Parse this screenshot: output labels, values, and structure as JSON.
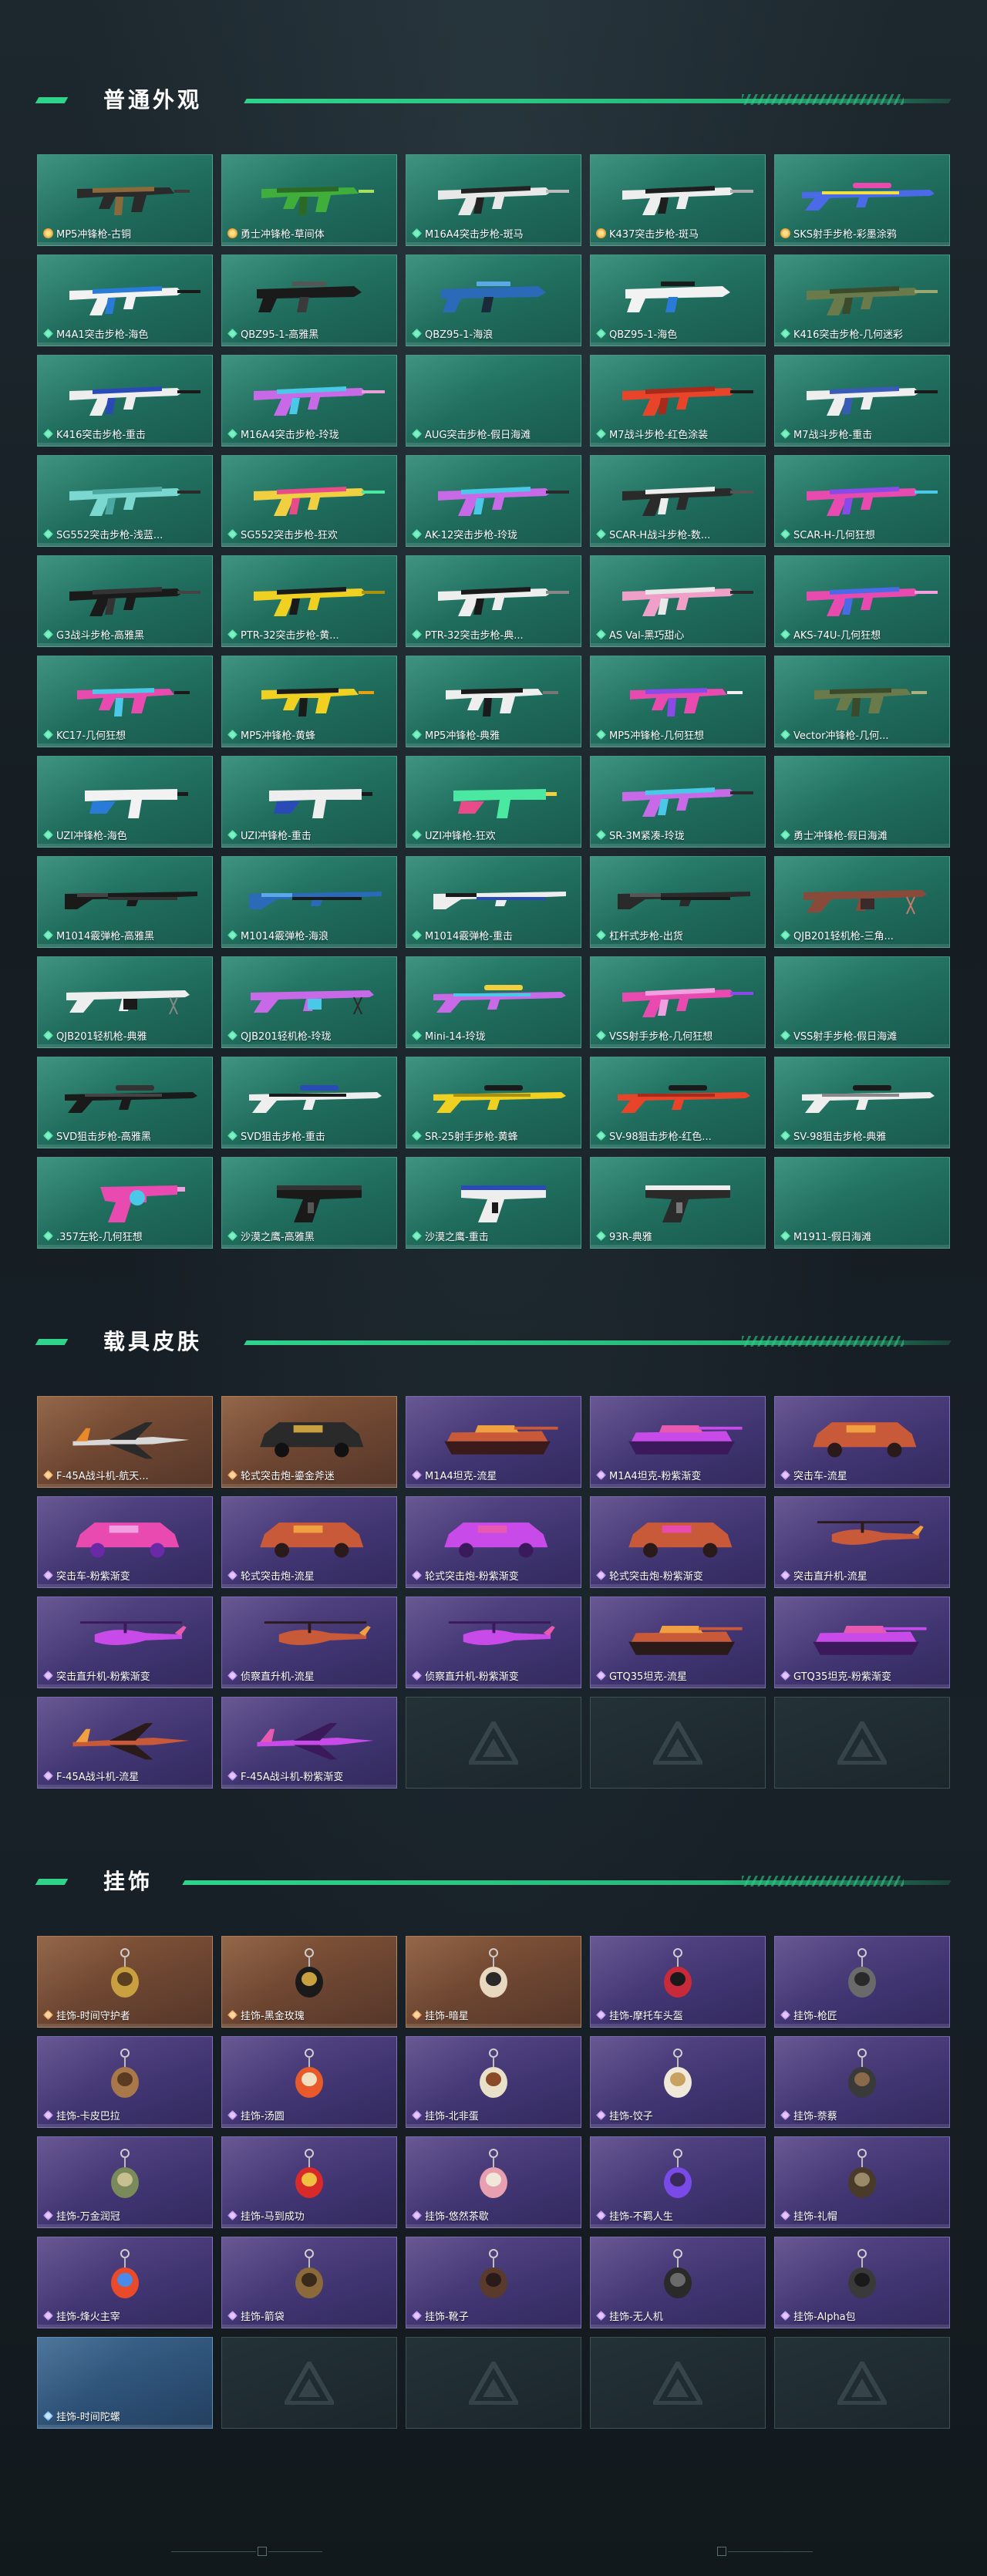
{
  "sections": [
    {
      "title": "普通外观"
    },
    {
      "title": "载具皮肤"
    },
    {
      "title": "挂饰"
    }
  ],
  "weapons": [
    {
      "name": "MP5冲锋枪-古铜",
      "rarity": "gold",
      "gun": "smg",
      "colors": [
        "#2a2a2a",
        "#8a6a3a",
        "#3a3a3a"
      ]
    },
    {
      "name": "勇士冲锋枪-草间体",
      "rarity": "gold",
      "gun": "smg",
      "colors": [
        "#3fae3a",
        "#2a6a25",
        "#a8e060"
      ]
    },
    {
      "name": "M16A4突击步枪-斑马",
      "rarity": "green",
      "gun": "rifle",
      "colors": [
        "#e8e8e8",
        "#222222",
        "#bbbbbb"
      ]
    },
    {
      "name": "K437突击步枪-斑马",
      "rarity": "gold",
      "gun": "rifle",
      "colors": [
        "#eeeeee",
        "#1e1e1e",
        "#aaaaaa"
      ]
    },
    {
      "name": "SKS射手步枪-彩墨涂鸦",
      "rarity": "gold",
      "gun": "sniper",
      "colors": [
        "#4a6ae8",
        "#e84ab0",
        "#f0e040"
      ]
    },
    {
      "name": "M4A1突击步枪-海色",
      "rarity": "green",
      "gun": "rifle",
      "colors": [
        "#f2f2f2",
        "#2a7ad8",
        "#1a1a1a"
      ]
    },
    {
      "name": "QBZ95-1-高雅黑",
      "rarity": "green",
      "gun": "bullpup",
      "colors": [
        "#1a1a1a",
        "#3a3a3a",
        "#555555"
      ]
    },
    {
      "name": "QBZ95-1-海浪",
      "rarity": "green",
      "gun": "bullpup",
      "colors": [
        "#2a6ab8",
        "#1a2a3a",
        "#5aa8e8"
      ]
    },
    {
      "name": "QBZ95-1-海色",
      "rarity": "green",
      "gun": "bullpup",
      "colors": [
        "#f2f2f2",
        "#2a7ad8",
        "#1a1a1a"
      ]
    },
    {
      "name": "K416突击步枪-几何迷彩",
      "rarity": "green",
      "gun": "rifle",
      "colors": [
        "#6a7a4a",
        "#3a4a2a",
        "#9aa870"
      ]
    },
    {
      "name": "K416突击步枪-重击",
      "rarity": "green",
      "gun": "rifle",
      "colors": [
        "#eeeeee",
        "#2a4ab8",
        "#1a1a1a"
      ]
    },
    {
      "name": "M16A4突击步枪-玲珑",
      "rarity": "green",
      "gun": "rifle",
      "colors": [
        "#c86ae8",
        "#4ac8e8",
        "#e8a0d8"
      ]
    },
    {
      "name": "AUG突击步枪-假日海滩",
      "rarity": "green",
      "gun": "none",
      "colors": [
        "#1f6b5c",
        "#1f6b5c",
        "#1f6b5c"
      ]
    },
    {
      "name": "M7战斗步枪-红色涂装",
      "rarity": "green",
      "gun": "rifle",
      "colors": [
        "#e8442a",
        "#a82a1a",
        "#1a1a1a"
      ]
    },
    {
      "name": "M7战斗步枪-重击",
      "rarity": "green",
      "gun": "rifle",
      "colors": [
        "#eeeeee",
        "#3a5ab8",
        "#1a1a1a"
      ]
    },
    {
      "name": "SG552突击步枪-浅蓝...",
      "rarity": "green",
      "gun": "rifle",
      "colors": [
        "#7ad8d0",
        "#4aa8a0",
        "#2a2a2a"
      ]
    },
    {
      "name": "SG552突击步枪-狂欢",
      "rarity": "green",
      "gun": "rifle",
      "colors": [
        "#f0d040",
        "#e84a8a",
        "#4ae8a0"
      ]
    },
    {
      "name": "AK-12突击步枪-玲珑",
      "rarity": "green",
      "gun": "rifle",
      "colors": [
        "#c86ae8",
        "#4ac8e8",
        "#2a2a2a"
      ]
    },
    {
      "name": "SCAR-H战斗步枪-数...",
      "rarity": "green",
      "gun": "rifle",
      "colors": [
        "#2a2a2a",
        "#eeeeee",
        "#555555"
      ]
    },
    {
      "name": "SCAR-H-几何狂想",
      "rarity": "green",
      "gun": "rifle",
      "colors": [
        "#e84ab0",
        "#8a4ae8",
        "#4ac8e8"
      ]
    },
    {
      "name": "G3战斗步枪-高雅黑",
      "rarity": "green",
      "gun": "rifle",
      "colors": [
        "#1a1a1a",
        "#333333",
        "#444444"
      ]
    },
    {
      "name": "PTR-32突击步枪-黄...",
      "rarity": "green",
      "gun": "rifle",
      "colors": [
        "#f0d020",
        "#1a1a1a",
        "#a89010"
      ]
    },
    {
      "name": "PTR-32突击步枪-典...",
      "rarity": "green",
      "gun": "rifle",
      "colors": [
        "#eeeeee",
        "#1a1a1a",
        "#888888"
      ]
    },
    {
      "name": "AS Val-黑巧甜心",
      "rarity": "green",
      "gun": "rifle",
      "colors": [
        "#f0a0c8",
        "#e8e8e8",
        "#2a2a2a"
      ]
    },
    {
      "name": "AKS-74U-几何狂想",
      "rarity": "green",
      "gun": "rifle",
      "colors": [
        "#e84ab0",
        "#4a6ae8",
        "#f0a0e0"
      ]
    },
    {
      "name": "KC17-几何狂想",
      "rarity": "green",
      "gun": "smg",
      "colors": [
        "#e84ab0",
        "#4ac8e8",
        "#1a1a1a"
      ]
    },
    {
      "name": "MP5冲锋枪-黄蜂",
      "rarity": "green",
      "gun": "smg",
      "colors": [
        "#f0d020",
        "#1a1a1a",
        "#e8a010"
      ]
    },
    {
      "name": "MP5冲锋枪-典雅",
      "rarity": "green",
      "gun": "smg",
      "colors": [
        "#eeeeee",
        "#1a1a1a",
        "#777777"
      ]
    },
    {
      "name": "MP5冲锋枪-几何狂想",
      "rarity": "green",
      "gun": "smg",
      "colors": [
        "#e84ab0",
        "#8a4ae8",
        "#f0f0f0"
      ]
    },
    {
      "name": "Vector冲锋枪-几何...",
      "rarity": "green",
      "gun": "smg",
      "colors": [
        "#6a7a4a",
        "#3a4a2a",
        "#aab080"
      ]
    },
    {
      "name": "UZI冲锋枪-海色",
      "rarity": "green",
      "gun": "uzi",
      "colors": [
        "#f2f2f2",
        "#2a7ad8",
        "#1a1a1a"
      ]
    },
    {
      "name": "UZI冲锋枪-重击",
      "rarity": "green",
      "gun": "uzi",
      "colors": [
        "#eeeeee",
        "#2a4ab8",
        "#1a1a1a"
      ]
    },
    {
      "name": "UZI冲锋枪-狂欢",
      "rarity": "green",
      "gun": "uzi",
      "colors": [
        "#4ae8a0",
        "#e84a8a",
        "#f0d040"
      ]
    },
    {
      "name": "SR-3M紧凑-玲珑",
      "rarity": "green",
      "gun": "rifle",
      "colors": [
        "#c86ae8",
        "#4ac8e8",
        "#2a2a2a"
      ]
    },
    {
      "name": "勇士冲锋枪-假日海滩",
      "rarity": "green",
      "gun": "none",
      "colors": [
        "#1f6b5c",
        "#1f6b5c",
        "#1f6b5c"
      ]
    },
    {
      "name": "M1014霰弹枪-高雅黑",
      "rarity": "green",
      "gun": "shotgun",
      "colors": [
        "#1a1a1a",
        "#333333",
        "#444444"
      ]
    },
    {
      "name": "M1014霰弹枪-海浪",
      "rarity": "green",
      "gun": "shotgun",
      "colors": [
        "#2a6ab8",
        "#1a1a1a",
        "#5aa8e8"
      ]
    },
    {
      "name": "M1014霰弹枪-重击",
      "rarity": "green",
      "gun": "shotgun",
      "colors": [
        "#eeeeee",
        "#2a4ab8",
        "#1a1a1a"
      ]
    },
    {
      "name": "杠杆式步枪-出货",
      "rarity": "green",
      "gun": "shotgun",
      "colors": [
        "#2a2a2a",
        "#1a1a1a",
        "#555555"
      ]
    },
    {
      "name": "QJB201轻机枪-三角...",
      "rarity": "green",
      "gun": "lmg",
      "colors": [
        "#8a4a3a",
        "#3a2a2a",
        "#c87a6a"
      ]
    },
    {
      "name": "QJB201轻机枪-典雅",
      "rarity": "green",
      "gun": "lmg",
      "colors": [
        "#eeeeee",
        "#1a1a1a",
        "#888888"
      ]
    },
    {
      "name": "QJB201轻机枪-玲珑",
      "rarity": "green",
      "gun": "lmg",
      "colors": [
        "#c86ae8",
        "#4ac8e8",
        "#2a2a2a"
      ]
    },
    {
      "name": "Mini-14-玲珑",
      "rarity": "green",
      "gun": "sniper",
      "colors": [
        "#c86ae8",
        "#f0d040",
        "#4ac8e8"
      ]
    },
    {
      "name": "VSS射手步枪-几何狂想",
      "rarity": "green",
      "gun": "rifle",
      "colors": [
        "#e84ab0",
        "#f0a0e0",
        "#8a4ae8"
      ]
    },
    {
      "name": "VSS射手步枪-假日海滩",
      "rarity": "green",
      "gun": "none",
      "colors": [
        "#1f6b5c",
        "#1f6b5c",
        "#1f6b5c"
      ]
    },
    {
      "name": "SVD狙击步枪-高雅黑",
      "rarity": "green",
      "gun": "sniper",
      "colors": [
        "#1a1a1a",
        "#333333",
        "#444444"
      ]
    },
    {
      "name": "SVD狙击步枪-重击",
      "rarity": "green",
      "gun": "sniper",
      "colors": [
        "#eeeeee",
        "#2a4ab8",
        "#1a1a1a"
      ]
    },
    {
      "name": "SR-25射手步枪-黄蜂",
      "rarity": "green",
      "gun": "sniper",
      "colors": [
        "#f0d020",
        "#1a1a1a",
        "#a89010"
      ]
    },
    {
      "name": "SV-98狙击步枪-红色...",
      "rarity": "green",
      "gun": "sniper",
      "colors": [
        "#e8442a",
        "#1a1a1a",
        "#a82a1a"
      ]
    },
    {
      "name": "SV-98狙击步枪-典雅",
      "rarity": "green",
      "gun": "sniper",
      "colors": [
        "#eeeeee",
        "#1a1a1a",
        "#888888"
      ]
    },
    {
      "name": ".357左轮-几何狂想",
      "rarity": "green",
      "gun": "revolver",
      "colors": [
        "#e84ab0",
        "#4ac8e8",
        "#f0a0e0"
      ]
    },
    {
      "name": "沙漠之鹰-高雅黑",
      "rarity": "green",
      "gun": "pistol",
      "colors": [
        "#1a1a1a",
        "#333333",
        "#555555"
      ]
    },
    {
      "name": "沙漠之鹰-重击",
      "rarity": "green",
      "gun": "pistol",
      "colors": [
        "#eeeeee",
        "#2a4ab8",
        "#1a1a1a"
      ]
    },
    {
      "name": "93R-典雅",
      "rarity": "green",
      "gun": "pistol",
      "colors": [
        "#2a2a2a",
        "#eeeeee",
        "#777777"
      ]
    },
    {
      "name": "M1911-假日海滩",
      "rarity": "green",
      "gun": "none",
      "colors": [
        "#1f6b5c",
        "#1f6b5c",
        "#1f6b5c"
      ]
    }
  ],
  "vehicles": [
    {
      "name": "F-45A战斗机-航天...",
      "rarity": "orange",
      "style": "orange",
      "kind": "jet",
      "colors": [
        "#d8d8d8",
        "#2a2a2a",
        "#e88a2a"
      ]
    },
    {
      "name": "轮式突击炮-鎏金斧迷",
      "rarity": "orange",
      "style": "orange",
      "kind": "truck",
      "colors": [
        "#2a2a2a",
        "#111111",
        "#c8a040"
      ]
    },
    {
      "name": "M1A4坦克-流星",
      "rarity": "purple",
      "style": "purple",
      "kind": "tank",
      "colors": [
        "#c85a3a",
        "#3a1a1a",
        "#f0a040"
      ]
    },
    {
      "name": "M1A4坦克-粉紫渐变",
      "rarity": "purple",
      "style": "purple",
      "kind": "tank",
      "colors": [
        "#c84ae8",
        "#3a1a5a",
        "#e85ab0"
      ]
    },
    {
      "name": "突击车-流星",
      "rarity": "purple",
      "style": "purple",
      "kind": "truck",
      "colors": [
        "#c85a3a",
        "#2a1a1a",
        "#f0a040"
      ]
    },
    {
      "name": "突击车-粉紫渐变",
      "rarity": "purple",
      "style": "purple",
      "kind": "truck",
      "colors": [
        "#e84ab0",
        "#6a2aa8",
        "#f0a0e0"
      ]
    },
    {
      "name": "轮式突击炮-流星",
      "rarity": "purple",
      "style": "purple",
      "kind": "truck",
      "colors": [
        "#c85a3a",
        "#2a1a1a",
        "#f0a040"
      ]
    },
    {
      "name": "轮式突击炮-粉紫渐变",
      "rarity": "purple",
      "style": "purple",
      "kind": "truck",
      "colors": [
        "#c84ae8",
        "#3a1a5a",
        "#e85ab0"
      ]
    },
    {
      "name": "轮式突击炮-粉紫渐变",
      "rarity": "purple",
      "style": "purple",
      "kind": "truck",
      "colors": [
        "#c85a3a",
        "#2a1a1a",
        "#e84ab0"
      ]
    },
    {
      "name": "突击直升机-流星",
      "rarity": "purple",
      "style": "purple",
      "kind": "heli",
      "colors": [
        "#c85a3a",
        "#2a1a1a",
        "#f0a040"
      ]
    },
    {
      "name": "突击直升机-粉紫渐变",
      "rarity": "purple",
      "style": "purple",
      "kind": "heli",
      "colors": [
        "#c84ae8",
        "#3a1a5a",
        "#e85ab0"
      ]
    },
    {
      "name": "侦察直升机-流星",
      "rarity": "purple",
      "style": "purple",
      "kind": "heli",
      "colors": [
        "#c85a3a",
        "#2a1a1a",
        "#f0a040"
      ]
    },
    {
      "name": "侦察直升机-粉紫渐变",
      "rarity": "purple",
      "style": "purple",
      "kind": "heli",
      "colors": [
        "#c84ae8",
        "#3a1a5a",
        "#e85ab0"
      ]
    },
    {
      "name": "GTQ35坦克-流星",
      "rarity": "purple",
      "style": "purple",
      "kind": "tank",
      "colors": [
        "#c85a3a",
        "#2a1a1a",
        "#f0a040"
      ]
    },
    {
      "name": "GTQ35坦克-粉紫渐变",
      "rarity": "purple",
      "style": "purple",
      "kind": "tank",
      "colors": [
        "#c84ae8",
        "#3a1a5a",
        "#e85ab0"
      ]
    },
    {
      "name": "F-45A战斗机-流星",
      "rarity": "purple",
      "style": "purple",
      "kind": "jet",
      "colors": [
        "#c85a3a",
        "#2a1a1a",
        "#f0a040"
      ]
    },
    {
      "name": "F-45A战斗机-粉紫渐变",
      "rarity": "purple",
      "style": "purple",
      "kind": "jet",
      "colors": [
        "#c84ae8",
        "#3a1a5a",
        "#e85ab0"
      ]
    },
    {
      "name": "",
      "rarity": "",
      "style": "empty",
      "kind": "none",
      "colors": []
    },
    {
      "name": "",
      "rarity": "",
      "style": "empty",
      "kind": "none",
      "colors": []
    },
    {
      "name": "",
      "rarity": "",
      "style": "empty",
      "kind": "none",
      "colors": []
    }
  ],
  "charms": [
    {
      "name": "挂饰-时间守护者",
      "rarity": "orange",
      "style": "orange",
      "colors": [
        "#c8a040",
        "#5a4020"
      ]
    },
    {
      "name": "挂饰-黑金玫瑰",
      "rarity": "orange",
      "style": "orange",
      "colors": [
        "#1a1a1a",
        "#c8a040"
      ]
    },
    {
      "name": "挂饰-暗星",
      "rarity": "orange",
      "style": "orange",
      "colors": [
        "#e8d8c0",
        "#2a2a2a"
      ]
    },
    {
      "name": "挂饰-摩托车头盔",
      "rarity": "purple",
      "style": "purple",
      "colors": [
        "#c82a3a",
        "#1a1a1a"
      ]
    },
    {
      "name": "挂饰-枪匠",
      "rarity": "purple",
      "style": "purple",
      "colors": [
        "#6a6a6a",
        "#2a2a2a"
      ]
    },
    {
      "name": "挂饰-卡皮巴拉",
      "rarity": "purple",
      "style": "purple",
      "colors": [
        "#a8784a",
        "#5a3a20"
      ]
    },
    {
      "name": "挂饰-汤圆",
      "rarity": "purple",
      "style": "purple",
      "colors": [
        "#e85a2a",
        "#f0e0c0"
      ]
    },
    {
      "name": "挂饰-北非蛋",
      "rarity": "purple",
      "style": "purple",
      "colors": [
        "#e8e0c8",
        "#8a4a2a"
      ]
    },
    {
      "name": "挂饰-饺子",
      "rarity": "purple",
      "style": "purple",
      "colors": [
        "#f0e8d8",
        "#c8a060"
      ]
    },
    {
      "name": "挂饰-萘蔡",
      "rarity": "purple",
      "style": "purple",
      "colors": [
        "#3a3a3a",
        "#8a6a4a"
      ]
    },
    {
      "name": "挂饰-万金润冠",
      "rarity": "purple",
      "style": "purple",
      "colors": [
        "#7a8a5a",
        "#c8c090"
      ]
    },
    {
      "name": "挂饰-马到成功",
      "rarity": "purple",
      "style": "purple",
      "colors": [
        "#d82a2a",
        "#f0c040"
      ]
    },
    {
      "name": "挂饰-悠然茶歇",
      "rarity": "purple",
      "style": "purple",
      "colors": [
        "#e8a0b0",
        "#f0e8d8"
      ]
    },
    {
      "name": "挂饰-不羁人生",
      "rarity": "purple",
      "style": "purple",
      "colors": [
        "#7a4ae8",
        "#3a2a5a"
      ]
    },
    {
      "name": "挂饰-礼帽",
      "rarity": "purple",
      "style": "purple",
      "colors": [
        "#4a3a2a",
        "#9a8a6a"
      ]
    },
    {
      "name": "挂饰-烽火主宰",
      "rarity": "purple",
      "style": "purple",
      "colors": [
        "#e84a2a",
        "#4a8ae8"
      ]
    },
    {
      "name": "挂饰-箭袋",
      "rarity": "purple",
      "style": "purple",
      "colors": [
        "#8a6a3a",
        "#3a2a1a"
      ]
    },
    {
      "name": "挂饰-靴子",
      "rarity": "purple",
      "style": "purple",
      "colors": [
        "#5a3a2a",
        "#2a1a1a"
      ]
    },
    {
      "name": "挂饰-无人机",
      "rarity": "purple",
      "style": "purple",
      "colors": [
        "#2a2a2a",
        "#6a6a6a"
      ]
    },
    {
      "name": "挂饰-Alpha包",
      "rarity": "purple",
      "style": "purple",
      "colors": [
        "#3a3a3a",
        "#1a1a1a"
      ]
    },
    {
      "name": "挂饰-时间陀螺",
      "rarity": "blue",
      "style": "blue",
      "colors": []
    },
    {
      "name": "",
      "rarity": "",
      "style": "empty",
      "colors": []
    },
    {
      "name": "",
      "rarity": "",
      "style": "empty",
      "colors": []
    },
    {
      "name": "",
      "rarity": "",
      "style": "empty",
      "colors": []
    },
    {
      "name": "",
      "rarity": "",
      "style": "empty",
      "colors": []
    }
  ]
}
